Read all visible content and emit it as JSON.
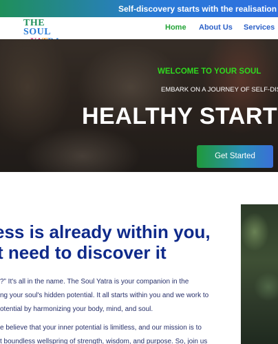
{
  "topbar": {
    "text": "Self-discovery starts with the realisation of h"
  },
  "logo": {
    "line1_prefix": "THE ",
    "line1_accent": "SOUL",
    "line2_part1": "YA",
    "line2_part2": "T",
    "line2_part3": "RA"
  },
  "nav": {
    "home": "Home",
    "about": "About Us",
    "services": "Services"
  },
  "hero": {
    "welcome": "WELCOME TO YOUR SOUL",
    "embark": "EMBARK ON A JOURNEY OF SELF-DIS",
    "title": "HEALTHY START",
    "button": "Get Started"
  },
  "about": {
    "heading_line1": "ess is already within you,",
    "heading_line2": "t need to discover it",
    "p1_lines": [
      "?” It's all in the name. The Soul Yatra is your companion in the",
      "ng your soul's hidden potential. It all starts within you and we work to",
      "otential by harmonizing your body, mind, and soul."
    ],
    "p2_lines": [
      "e believe that your inner potential is limitless, and our mission is to",
      "t boundless wellspring of strength, wisdom, and purpose. So, join us"
    ]
  },
  "colors": {
    "topbar_start": "#1f8f5a",
    "topbar_end": "#2f6fe0",
    "nav_home": "#22a336",
    "nav_link": "#2a5fc7",
    "heading": "#0f2a8a",
    "welcome": "#2fd81f"
  }
}
